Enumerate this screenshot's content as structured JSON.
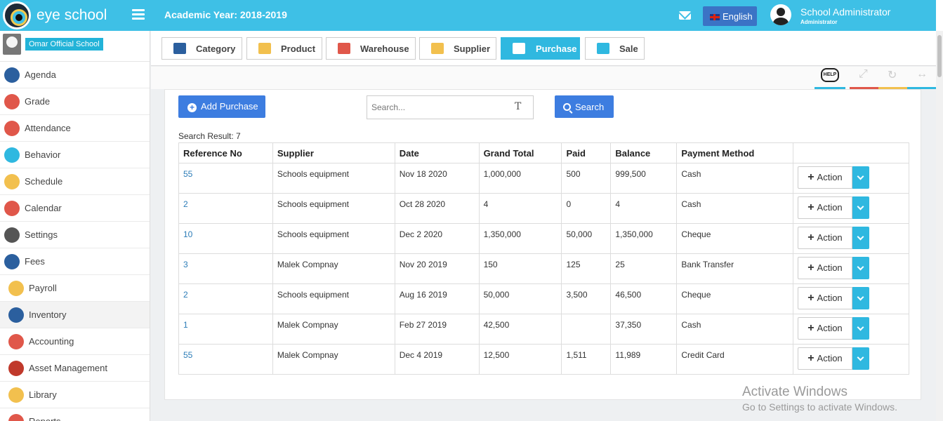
{
  "header": {
    "brand": "eye school",
    "academic_year": "Academic Year: 2018-2019",
    "language": "English",
    "user_name": "School Administrator",
    "user_role": "Administrator",
    "accent_color": "#3ec0e6"
  },
  "sidebar": {
    "school_name": "Omar Official School",
    "items": [
      {
        "label": "Agenda",
        "icon": "agenda-icon"
      },
      {
        "label": "Grade",
        "icon": "grade-icon"
      },
      {
        "label": "Attendance",
        "icon": "attendance-icon"
      },
      {
        "label": "Behavior",
        "icon": "behavior-icon"
      },
      {
        "label": "Schedule",
        "icon": "schedule-icon"
      },
      {
        "label": "Calendar",
        "icon": "calendar-icon"
      },
      {
        "label": "Settings",
        "icon": "settings-icon"
      },
      {
        "label": "Fees",
        "icon": "fees-icon"
      },
      {
        "label": "Payroll",
        "icon": "payroll-icon"
      },
      {
        "label": "Inventory",
        "icon": "inventory-icon",
        "active": true
      },
      {
        "label": "Accounting",
        "icon": "accounting-icon"
      },
      {
        "label": "Asset Management",
        "icon": "asset-management-icon"
      },
      {
        "label": "Library",
        "icon": "library-icon"
      },
      {
        "label": "Reports",
        "icon": "reports-icon"
      }
    ]
  },
  "tabs": [
    {
      "label": "Category",
      "icon": "category-icon"
    },
    {
      "label": "Product",
      "icon": "product-icon"
    },
    {
      "label": "Warehouse",
      "icon": "warehouse-icon"
    },
    {
      "label": "Supplier",
      "icon": "supplier-icon"
    },
    {
      "label": "Purchase",
      "icon": "purchase-icon",
      "active": true
    },
    {
      "label": "Sale",
      "icon": "sale-icon"
    }
  ],
  "toolbar": {
    "help_label": "HELP"
  },
  "main": {
    "add_button": "Add Purchase",
    "search_placeholder": "Search...",
    "search_button": "Search",
    "result_text": "Search Result: 7",
    "columns": [
      "Reference No",
      "Supplier",
      "Date",
      "Grand Total",
      "Paid",
      "Balance",
      "Payment Method",
      ""
    ],
    "action_label": "Action",
    "rows": [
      {
        "ref": "55",
        "supplier": "Schools equipment",
        "date": "Nov 18 2020",
        "total": "1,000,000",
        "paid": "500",
        "balance": "999,500",
        "method": "Cash"
      },
      {
        "ref": "2",
        "supplier": "Schools equipment",
        "date": "Oct 28 2020",
        "total": "4",
        "paid": "0",
        "balance": "4",
        "method": "Cash"
      },
      {
        "ref": "10",
        "supplier": "Schools equipment",
        "date": "Dec 2 2020",
        "total": "1,350,000",
        "paid": "50,000",
        "balance": "1,350,000",
        "method": "Cheque"
      },
      {
        "ref": "3",
        "supplier": "Malek Compnay",
        "date": "Nov 20 2019",
        "total": "150",
        "paid": "125",
        "balance": "25",
        "method": "Bank Transfer"
      },
      {
        "ref": "2",
        "supplier": "Schools equipment",
        "date": "Aug 16 2019",
        "total": "50,000",
        "paid": "3,500",
        "balance": "46,500",
        "method": "Cheque"
      },
      {
        "ref": "1",
        "supplier": "Malek Compnay",
        "date": "Feb 27 2019",
        "total": "42,500",
        "paid": "",
        "balance": "37,350",
        "method": "Cash"
      },
      {
        "ref": "55",
        "supplier": "Malek Compnay",
        "date": "Dec 4 2019",
        "total": "12,500",
        "paid": "1,511",
        "balance": "11,989",
        "method": "Credit Card"
      }
    ]
  },
  "watermark": {
    "line1": "Activate Windows",
    "line2": "Go to Settings to activate Windows."
  }
}
